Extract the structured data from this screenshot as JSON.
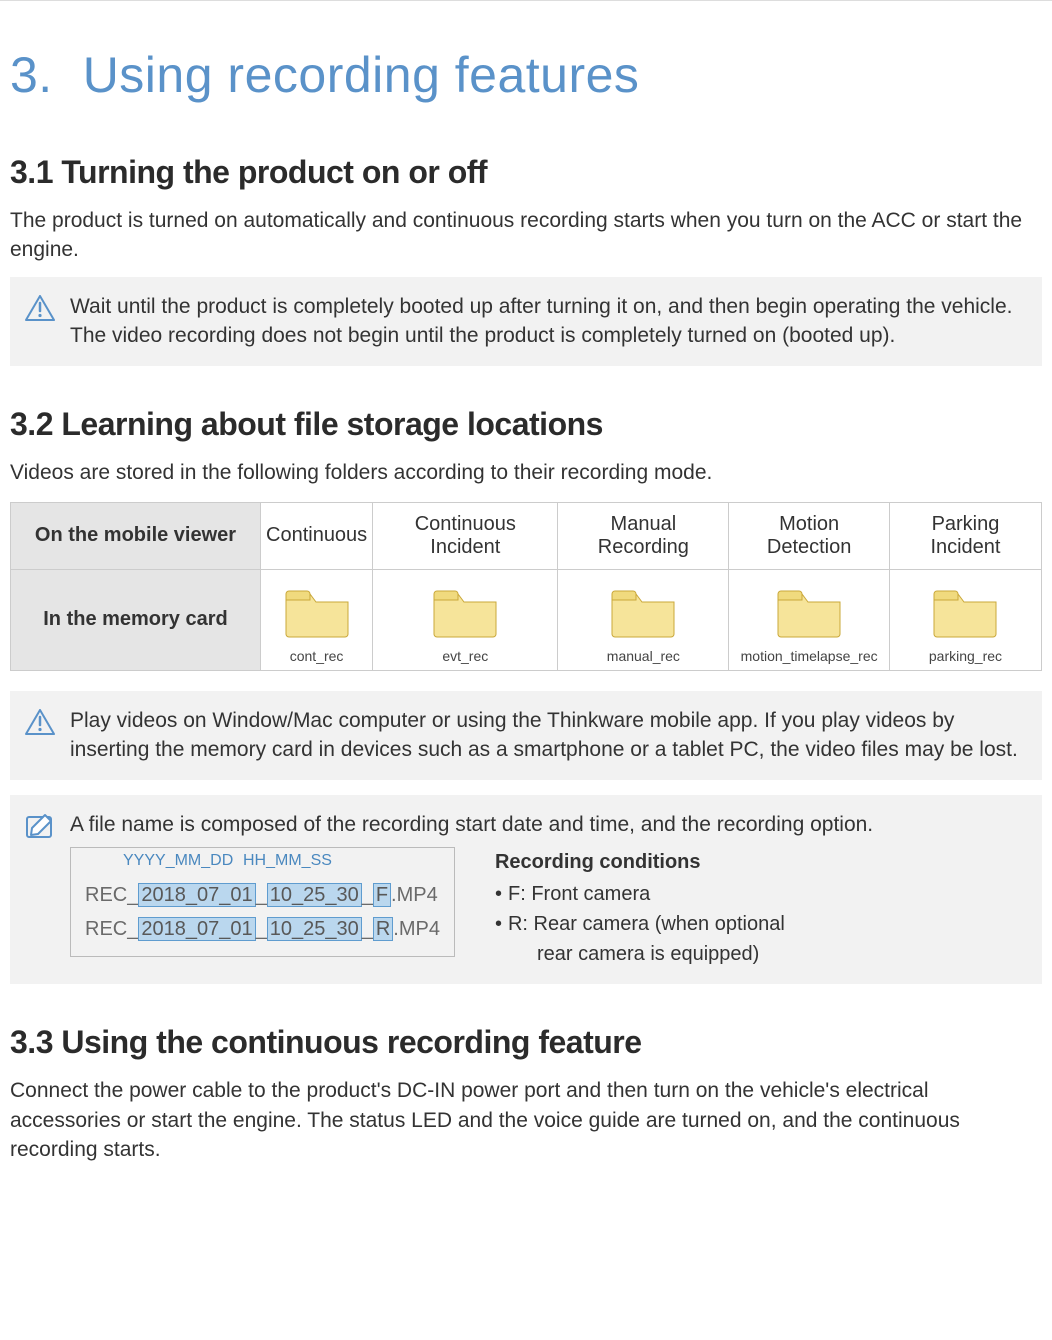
{
  "chapter": {
    "number": "3.",
    "title": "Using recording features"
  },
  "section31": {
    "heading": "3.1   Turning the product on or off",
    "para": "The product is turned on automatically and continuous recording starts when you turn on the ACC or start the engine.",
    "note": "Wait until the product is completely booted up after turning it on, and then begin operating the vehicle. The video recording does not begin until the product is completely turned on (booted up)."
  },
  "section32": {
    "heading": "3.2   Learning about file storage locations",
    "para": "Videos are stored in the following folders according to their recording mode.",
    "table": {
      "row1_header": "On the mobile viewer",
      "row2_header": "In the memory card",
      "cols": [
        {
          "viewer": "Continuous",
          "folder": "cont_rec"
        },
        {
          "viewer": "Continuous Incident",
          "folder": "evt_rec"
        },
        {
          "viewer": "Manual Recording",
          "folder": "manual_rec"
        },
        {
          "viewer": "Motion Detection",
          "folder": "motion_timelapse_rec"
        },
        {
          "viewer": "Parking Incident",
          "folder": "parking_rec"
        }
      ]
    },
    "note1": "Play videos on Window/Mac computer or using the Thinkware mobile app. If you play videos by inserting the memory card in devices such as a smartphone or a tablet PC, the video files may be lost.",
    "note2": {
      "intro": "A file name is composed of the recording start date and time, and the recording option.",
      "labels": {
        "date": "YYYY_MM_DD",
        "time": "HH_MM_SS"
      },
      "line1": {
        "pre": "REC_",
        "date": "2018_07_01",
        "sep1": "_",
        "time": "10_25_30",
        "sep2": "_",
        "opt": "F",
        "ext": ".MP4"
      },
      "line2": {
        "pre": "REC_",
        "date": "2018_07_01",
        "sep1": "_",
        "time": "10_25_30",
        "sep2": "_",
        "opt": "R",
        "ext": ".MP4"
      },
      "conditions_title": "Recording conditions",
      "cond_f": "F: Front camera",
      "cond_r": "R: Rear camera (when optional",
      "cond_r_sub": "rear camera is equipped)"
    }
  },
  "section33": {
    "heading": "3.3   Using the continuous recording feature",
    "para": "Connect the power cable to the product's DC-IN power port and then turn on the vehicle's electrical accessories or start the engine. The status LED and the voice guide are turned on, and the continuous recording starts."
  }
}
